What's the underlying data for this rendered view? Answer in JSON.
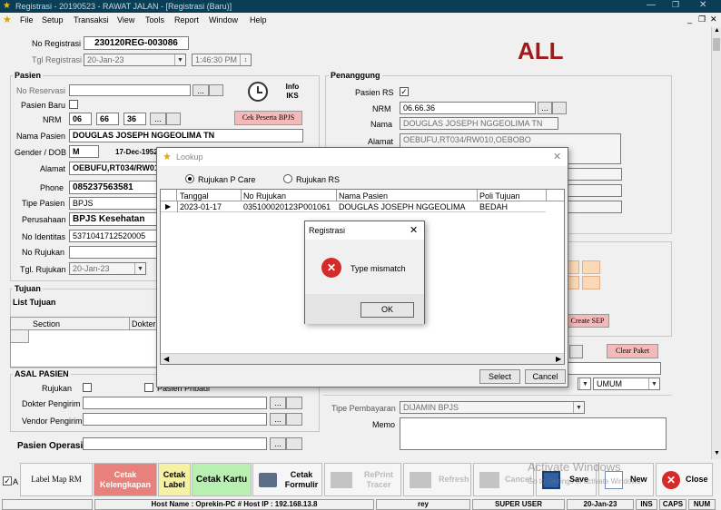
{
  "window": {
    "title": "Registrasi - 20190523 - RAWAT JALAN - [Registrasi (Baru)]"
  },
  "menu": [
    "File",
    "Setup",
    "Transaksi",
    "View",
    "Tools",
    "Report",
    "Window",
    "Help"
  ],
  "header": {
    "no_registrasi_label": "No Registrasi",
    "no_registrasi": "230120REG-003086",
    "tgl_registrasi_label": "Tgl Registrasi",
    "tgl_registrasi": "20-Jan-23",
    "time": "1:46:30 PM",
    "big_label": "ALL"
  },
  "pasien": {
    "section": "Pasien",
    "no_reservasi_label": "No Reservasi",
    "pasien_baru_label": "Pasien Baru",
    "nrm_label": "NRM",
    "nrm": [
      "06",
      "66",
      "36"
    ],
    "nama_label": "Nama Pasien",
    "nama": "DOUGLAS JOSEPH NGGEOLIMA TN",
    "gender_label": "Gender / DOB",
    "gender": "M",
    "dob": "17-Dec-1952",
    "alamat_label": "Alamat",
    "alamat": "OEBUFU,RT034/RW01",
    "phone_label": "Phone",
    "phone": "085237563581",
    "tipe_label": "Tipe Pasien",
    "tipe": "BPJS",
    "perusahaan_label": "Perusahaan",
    "perusahaan": "BPJS Kesehatan",
    "no_identitas_label": "No Identitas",
    "no_identitas": "5371041712520005",
    "no_rujukan_label": "No Rujukan",
    "tgl_rujukan_label": "Tgl. Rujukan",
    "tgl_rujukan": "20-Jan-23",
    "info_iks": "Info IKS",
    "cek_bpjs": "Cek Peserta BPJS"
  },
  "penanggung": {
    "section": "Penanggung",
    "pasien_rs_label": "Pasien RS",
    "nrm_label": "NRM",
    "nrm": "06.66.36",
    "nama_label": "Nama",
    "nama": "DOUGLAS JOSEPH NGGEOLIMA TN",
    "alamat_label": "Alamat",
    "alamat": "OEBUFU,RT034/RW010,OEBOBO"
  },
  "tujuan": {
    "section": "Tujuan",
    "list_label": "List Tujuan",
    "col_section": "Section",
    "col_dokter": "Dokter"
  },
  "asal": {
    "section": "ASAL PASIEN",
    "rujukan_label": "Rujukan",
    "pasien_pribadi": "Pasien Pribadi",
    "dokter_pengirim_label": "Dokter Pengirim",
    "vendor_pengirim_label": "Vendor Pengirim"
  },
  "pasien_operasi_label": "Pasien Operasi",
  "right": {
    "create_sep": "Create SEP",
    "clear_paket": "Clear Paket",
    "umum": "UMUM",
    "tipe_pembayaran_label": "Tipe Pembayaran",
    "tipe_pembayaran": "DIJAMIN BPJS",
    "memo_label": "Memo"
  },
  "lookup": {
    "title": "Lookup",
    "radio1": "Rujukan P Care",
    "radio2": "Rujukan RS",
    "columns": [
      "Tanggal",
      "No Rujukan",
      "Nama Pasien",
      "Poli Tujuan"
    ],
    "rows": [
      [
        "2023-01-17",
        "035100020123P001061",
        "DOUGLAS JOSEPH NGGEOLIMA",
        "BEDAH"
      ]
    ],
    "select": "Select",
    "cancel": "Cancel"
  },
  "msgbox": {
    "title": "Registrasi",
    "message": "Type mismatch",
    "ok": "OK"
  },
  "toolbar": {
    "label_map": "Label Map RM",
    "cetak_kelengkapan": "Cetak Kelengkapan",
    "cetak_label": "Cetak Label",
    "cetak_kartu": "Cetak Kartu",
    "cetak_formulir": "Cetak Formulir",
    "reprint": "RePrint Tracer",
    "refresh": "Refresh",
    "cancel": "Cancel",
    "save": "Save",
    "new": "New",
    "close": "Close"
  },
  "watermark": {
    "line1": "Activate Windows",
    "line2": "Go to Settings to activate Windows."
  },
  "status": {
    "host": "Host Name : Oprekin-PC # Host IP : 192.168.13.8",
    "user": "rey",
    "role": "SUPER USER",
    "date": "20-Jan-23",
    "ins": "INS",
    "caps": "CAPS",
    "num": "NUM"
  },
  "colors": {
    "titlebar": "#0a3e57",
    "ok_green": "#b7f0b0",
    "pink": "#f6b9b9",
    "red_big": "#a11a1a"
  }
}
